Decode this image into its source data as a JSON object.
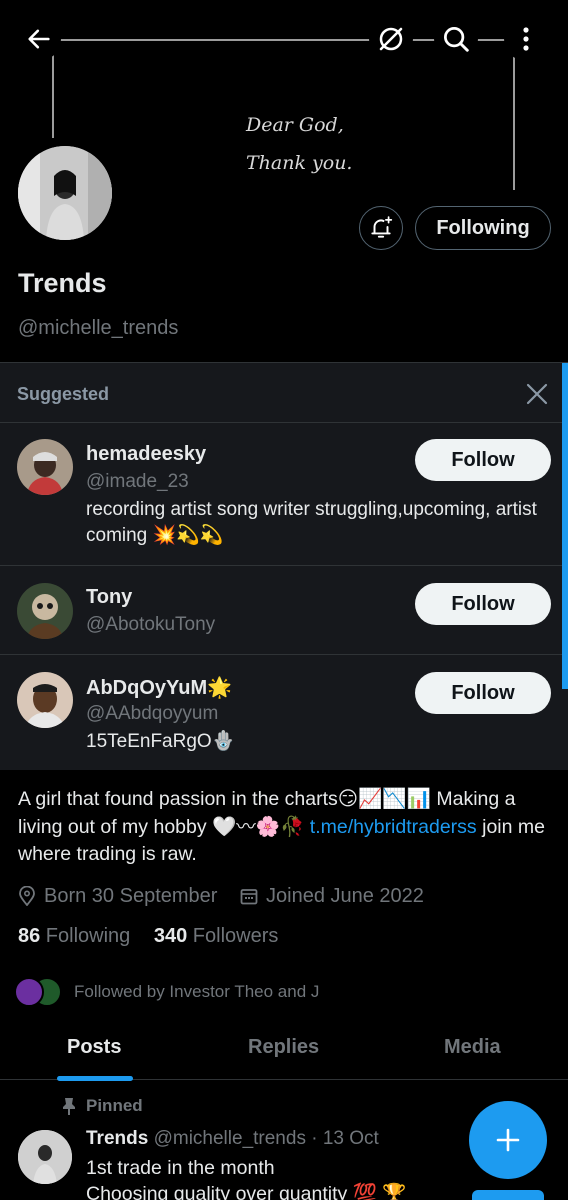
{
  "banner": {
    "line1": "Dear God,",
    "line2": "Thank you."
  },
  "profile": {
    "display_name": "Trends",
    "handle": "@michelle_trends",
    "following_label": "Following"
  },
  "suggested": {
    "title": "Suggested",
    "follow_label": "Follow",
    "users": [
      {
        "name": "hemadeesky",
        "handle": "@imade_23",
        "bio": "recording artist  song writer  struggling,upcoming, artist  coming 💥💫💫"
      },
      {
        "name": "Tony",
        "handle": "@AbotokuTony",
        "bio": ""
      },
      {
        "name": "AbDqOyYuM🌟",
        "handle": "@AAbdqoyyum",
        "bio": "15TeEnFaRgO🪬"
      }
    ]
  },
  "bio": {
    "text": "A girl that found passion in the charts😏📈📉📊 Making a living out of my hobby 🤍〰🌸🥀 ",
    "link": "t.me/hybridtraderss",
    "text_after": " join me where trading is raw."
  },
  "meta": {
    "birthday": "Born 30 September",
    "joined": "Joined June 2022"
  },
  "counts": {
    "following_count": "86",
    "following_label": " Following",
    "followers_count": "340",
    "followers_label": " Followers"
  },
  "followed_by": "Followed by Investor Theo and J",
  "tabs": [
    "Posts",
    "Replies",
    "Media"
  ],
  "post": {
    "pinned_label": "Pinned",
    "name": "Trends",
    "meta": " @michelle_trends · 13 Oct",
    "line1": "1st trade in the month",
    "line2": "Choosing quality over quantity 💯 🏆"
  },
  "colors": {
    "accent": "#1d9bf0",
    "background": "#000000",
    "panel": "#16181c",
    "muted": "#71767b"
  },
  "icons": [
    "back-arrow-icon",
    "no-signal-icon",
    "search-icon",
    "more-vertical-icon",
    "bell-plus-icon",
    "close-icon",
    "location-icon",
    "calendar-icon",
    "pin-icon",
    "plus-icon"
  ]
}
